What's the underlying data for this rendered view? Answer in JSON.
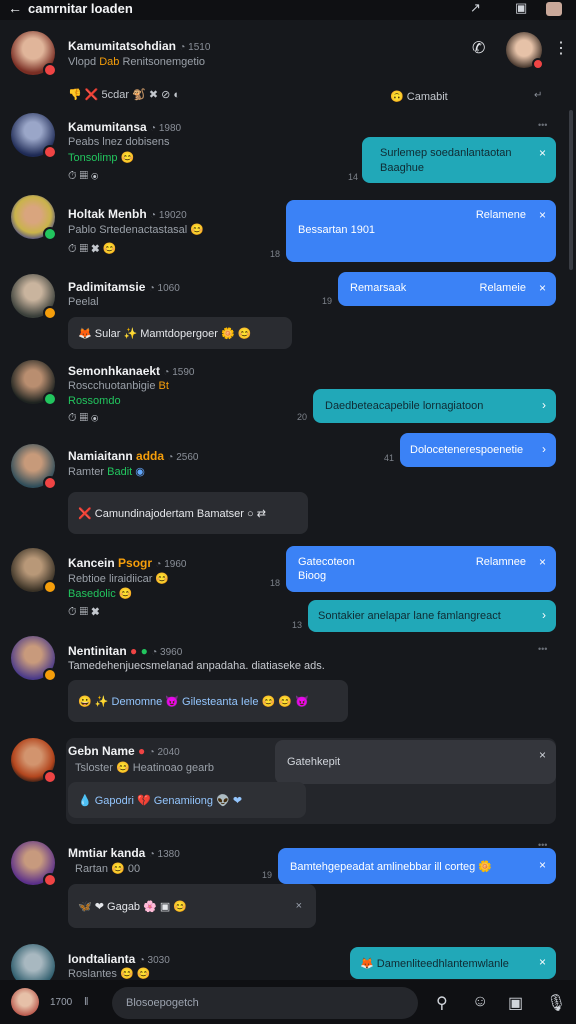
{
  "app": {
    "title": "camrnitar loaden"
  },
  "header_contact": {
    "name": "Kamumitatsohdian",
    "meta": "◔ 1510",
    "sub1": "Vlopd",
    "sub_tag": "Dab",
    "sub2": "Renitsonemgetio",
    "reactions": "👎 ❌ 5cdar 🐒 ✖ ⊘ ◐",
    "pill": "Camabit"
  },
  "messages": [
    {
      "name": "Kamumitansa",
      "meta": "◔ 1980",
      "sub": "Peabs lnez dobisens",
      "sub2": "Tonsolimp 😊",
      "icons": "⏱ ▦ ⦿",
      "bubble": "Surlemep soedanlantaotan Baaghue",
      "bubble_type": "teal",
      "time": "14"
    },
    {
      "name": "Holtak Menbh",
      "meta": "◔ 19020",
      "sub": "Pablo Srtedenactastasal 😊",
      "icons": "⏱ ▦ ✖ 😊",
      "bubble": "Bessartan 1901",
      "bubble_right": "Relamene",
      "bubble_type": "blue",
      "time": "18"
    },
    {
      "name": "Padimitamsie",
      "meta": "◔ 1060",
      "sub": "Peelal",
      "bubble_left": "🦊 Sular  ✨ Mamtdopergoer 🌼 😊",
      "bubble": "Remarsaak",
      "bubble_right": "Relameie",
      "bubble_type": "blue",
      "time": "19"
    },
    {
      "name": "Semonhkanaekt",
      "meta": "◔ 1590",
      "sub": "Roscchuotanbigie",
      "sub_tag": "Bt",
      "sub2": "Rossomdo",
      "icons": "⏱ ▦ ⦿",
      "bubble": "Daedbeteacapebile lornagiatoon",
      "bubble_type": "teal",
      "time": "20",
      "bubble2": "Dolocetenerespoenetie",
      "time2": "41"
    },
    {
      "name": "Namiaitann",
      "name_tag": "adda",
      "meta": "◔ 2560",
      "sub": "Ramter",
      "sub_tag": "Badit",
      "bubble_left": "❌ Camundinajodertam Bamatser ○ ⇄"
    },
    {
      "name": "Kancein",
      "name_tag": "Psogr",
      "meta": "◔ 1960",
      "sub": "Rebtioe liraidiicar 😊",
      "sub2": "Basedolic 😊",
      "icons": "⏱ ▦ ✖",
      "bubble": "Gatecoteon Bioog",
      "bubble_right": "Relamnee",
      "bubble_type": "blue",
      "time": "18",
      "bubble2": "Sontakier anelapar lane famlangreact",
      "time2": "13"
    },
    {
      "name": "Nentinitan",
      "meta": "◔ 3960",
      "sub": "Tamedehenjuecsmelanad anpadaha. diatiaseke ads.",
      "bubble_left": "😀 ✨ Demomne  😈 Gilesteanta Iele 😊 😊 😈"
    },
    {
      "name": "Gebn Name",
      "meta": "◔ 2040",
      "sub": "Tsloster 😊 Heatinoao gearb",
      "bubble_left": "💧 Gapodri  💔 Genamiiong 👽 ❤",
      "bubble": "Gatehkepit",
      "bubble_type": "gray"
    },
    {
      "name": "Mmtiar kanda",
      "meta": "◔ 1380",
      "sub": "Rartan 😊 00",
      "bubble_left": "🦋 ❤ Gagab 🌸 ▣ 😊",
      "bubble": "Bamtehgepeadat amlinebbar ill corteg 🌼",
      "bubble_type": "blue",
      "time": "19"
    },
    {
      "name": "Iondtalianta",
      "meta": "◔ 3030",
      "sub": "Roslantes 😊 😊",
      "bubble": "🦊 Damenliteedhlantemwlanle",
      "bubble_type": "teal"
    }
  ],
  "composer": {
    "time": "1700",
    "placeholder": "Blosoepogetch"
  },
  "colors": {
    "teal": "#21a8b8",
    "blue": "#3b82f6",
    "bg": "#16181c"
  }
}
